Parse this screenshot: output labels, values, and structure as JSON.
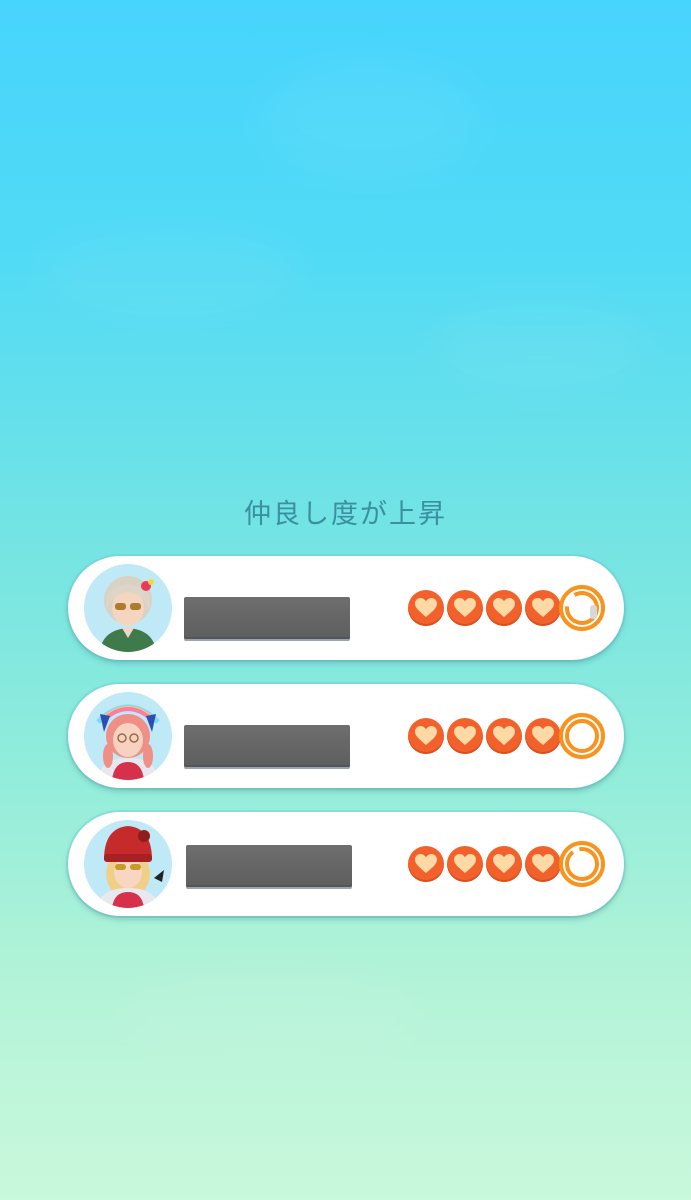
{
  "screen": {
    "title": "仲良し度が上昇"
  },
  "friends": [
    {
      "avatar_icon": "trainer-avatar-silver-hair-icon",
      "name_redacted": true,
      "hearts_filled": 4,
      "hearts_total": 5,
      "next_heart_progress": 0.85
    },
    {
      "avatar_icon": "trainer-avatar-pink-hair-icon",
      "name_redacted": true,
      "hearts_filled": 4,
      "hearts_total": 5,
      "next_heart_progress": 1.0
    },
    {
      "avatar_icon": "trainer-avatar-red-hat-icon",
      "name_redacted": true,
      "hearts_filled": 4,
      "hearts_total": 5,
      "next_heart_progress": 0.92
    }
  ],
  "colors": {
    "heart_fill": "#f2612b",
    "heart_symbol": "#ffd9a3",
    "ring": "#f7931e",
    "background_top": "#47d4fd",
    "background_bottom": "#c9f8dc"
  }
}
